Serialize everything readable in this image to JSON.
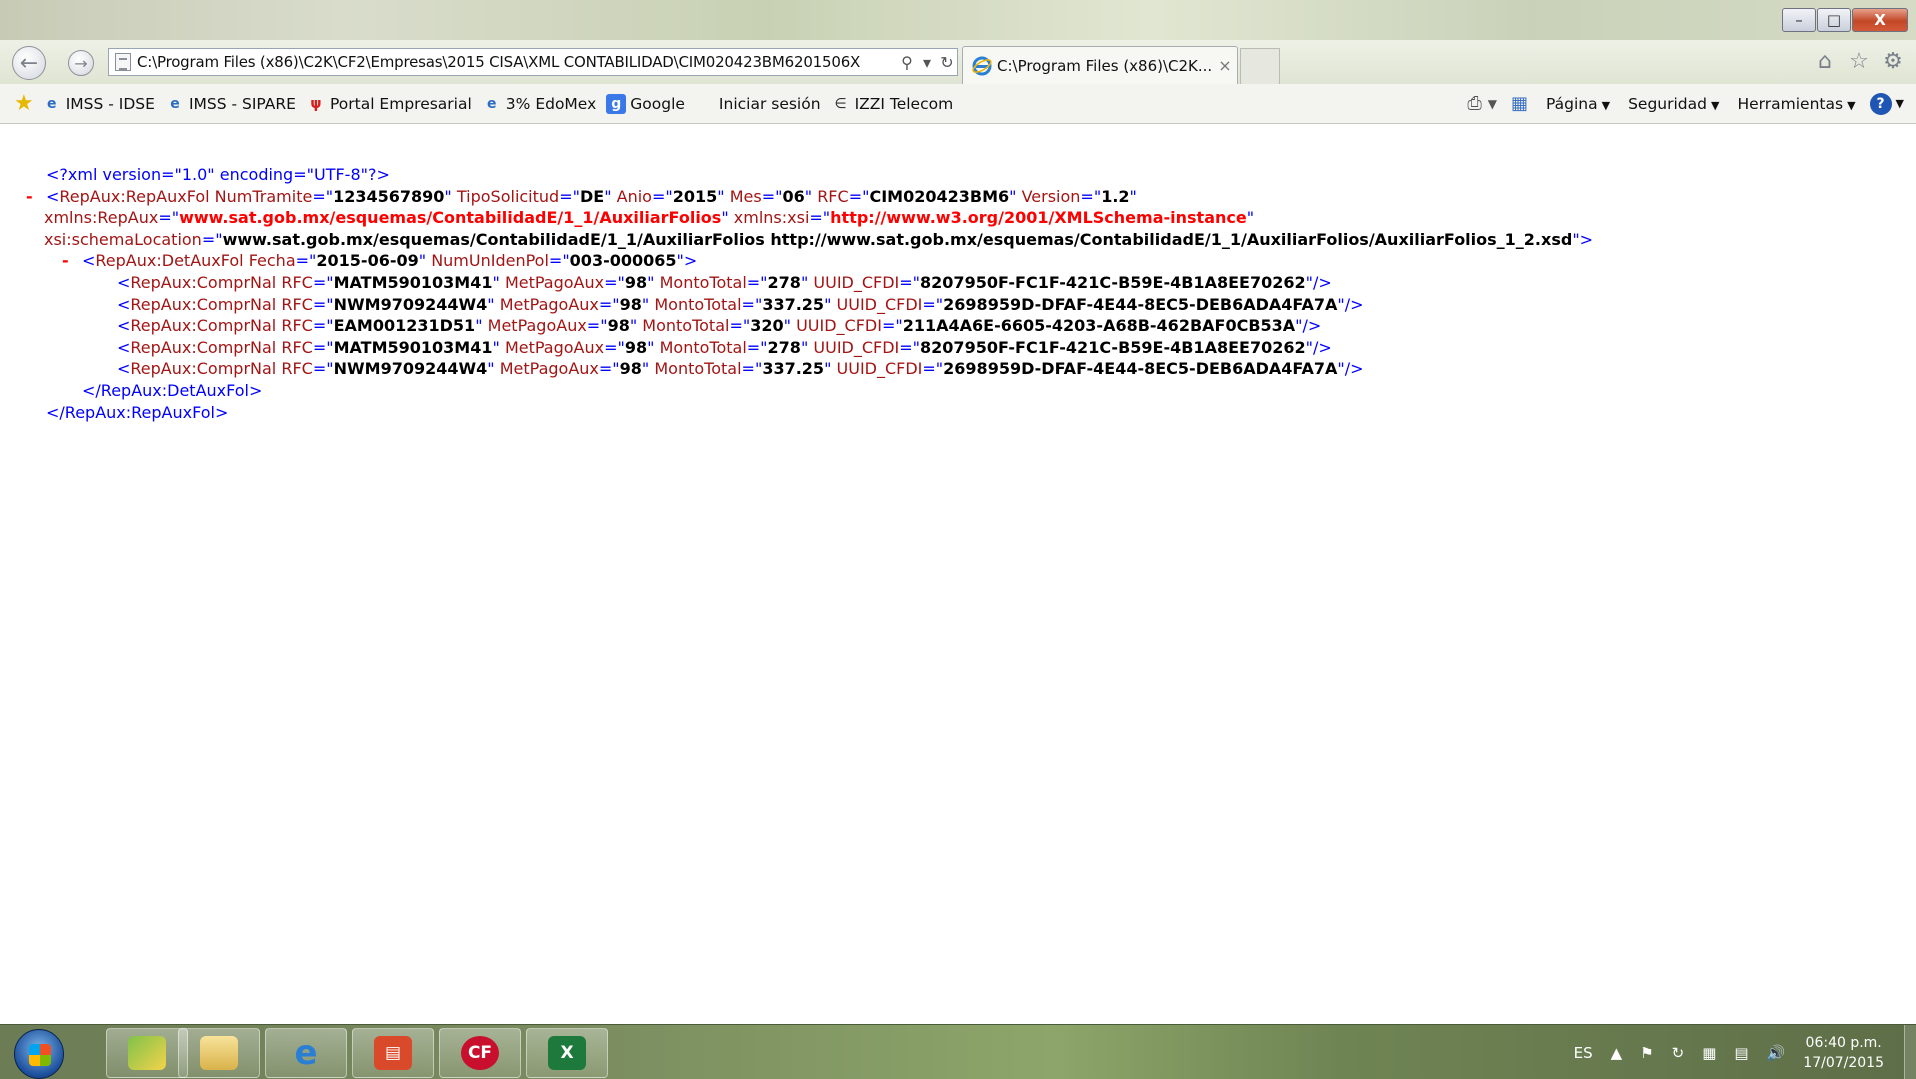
{
  "window": {
    "minimize_label": "–",
    "maximize_label": "□",
    "close_label": "X"
  },
  "navbar": {
    "address": "C:\\Program Files (x86)\\C2K\\CF2\\Empresas\\2015 CISA\\XML CONTABILIDAD\\CIM020423BM6201506X",
    "tab_title": "C:\\Program Files (x86)\\C2K...",
    "tab_close": "×",
    "search_glyph": "⚲",
    "dropdown_glyph": "▾",
    "refresh_glyph": "↻"
  },
  "favorites": [
    {
      "label": "IMSS - IDSE",
      "icon": "ie-page-icon"
    },
    {
      "label": "IMSS - SIPARE",
      "icon": "ie-page-icon"
    },
    {
      "label": "Portal Empresarial",
      "icon": "portal-icon"
    },
    {
      "label": "3% EdoMex",
      "icon": "ie-page-icon"
    },
    {
      "label": "Google",
      "icon": "google-icon"
    },
    {
      "label": "Iniciar sesión",
      "icon": "microsoft-icon"
    },
    {
      "label": "IZZI Telecom",
      "icon": "izzi-icon"
    }
  ],
  "commandbar": {
    "page": "Página",
    "safety": "Seguridad",
    "tools": "Herramientas"
  },
  "xml": {
    "decl": "<?xml version=\"1.0\" encoding=\"UTF-8\"?>",
    "root": {
      "tag": "RepAux:RepAuxFol",
      "NumTramite": "1234567890",
      "TipoSolicitud": "DE",
      "Anio": "2015",
      "Mes": "06",
      "RFC": "CIM020423BM6",
      "Version": "1.2",
      "xmlns_RepAux": "www.sat.gob.mx/esquemas/ContabilidadE/1_1/AuxiliarFolios",
      "xmlns_xsi": "http://www.w3.org/2001/XMLSchema-instance",
      "schemaLocation": "www.sat.gob.mx/esquemas/ContabilidadE/1_1/AuxiliarFolios http://www.sat.gob.mx/esquemas/ContabilidadE/1_1/AuxiliarFolios/AuxiliarFolios_1_2.xsd",
      "close": "</RepAux:RepAuxFol>"
    },
    "det": {
      "tag": "RepAux:DetAuxFol",
      "Fecha": "2015-06-09",
      "NumUnIdenPol": "003-000065",
      "close": "</RepAux:DetAuxFol>"
    },
    "items": [
      {
        "RFC": "MATM590103M41",
        "MetPagoAux": "98",
        "MontoTotal": "278",
        "UUID_CFDI": "8207950F-FC1F-421C-B59E-4B1A8EE70262"
      },
      {
        "RFC": "NWM9709244W4",
        "MetPagoAux": "98",
        "MontoTotal": "337.25",
        "UUID_CFDI": "2698959D-DFAF-4E44-8EC5-DEB6ADA4FA7A"
      },
      {
        "RFC": "EAM001231D51",
        "MetPagoAux": "98",
        "MontoTotal": "320",
        "UUID_CFDI": "211A4A6E-6605-4203-A68B-462BAF0CB53A"
      },
      {
        "RFC": "MATM590103M41",
        "MetPagoAux": "98",
        "MontoTotal": "278",
        "UUID_CFDI": "8207950F-FC1F-421C-B59E-4B1A8EE70262"
      },
      {
        "RFC": "NWM9709244W4",
        "MetPagoAux": "98",
        "MontoTotal": "337.25",
        "UUID_CFDI": "2698959D-DFAF-4E44-8EC5-DEB6ADA4FA7A"
      }
    ]
  },
  "taskbar": {
    "apps": [
      "explorer-icon",
      "file-manager-icon",
      "internet-explorer-icon",
      "reports-icon",
      "cf-icon",
      "excel-icon"
    ],
    "lang": "ES",
    "time": "06:40 p.m.",
    "date": "17/07/2015"
  }
}
